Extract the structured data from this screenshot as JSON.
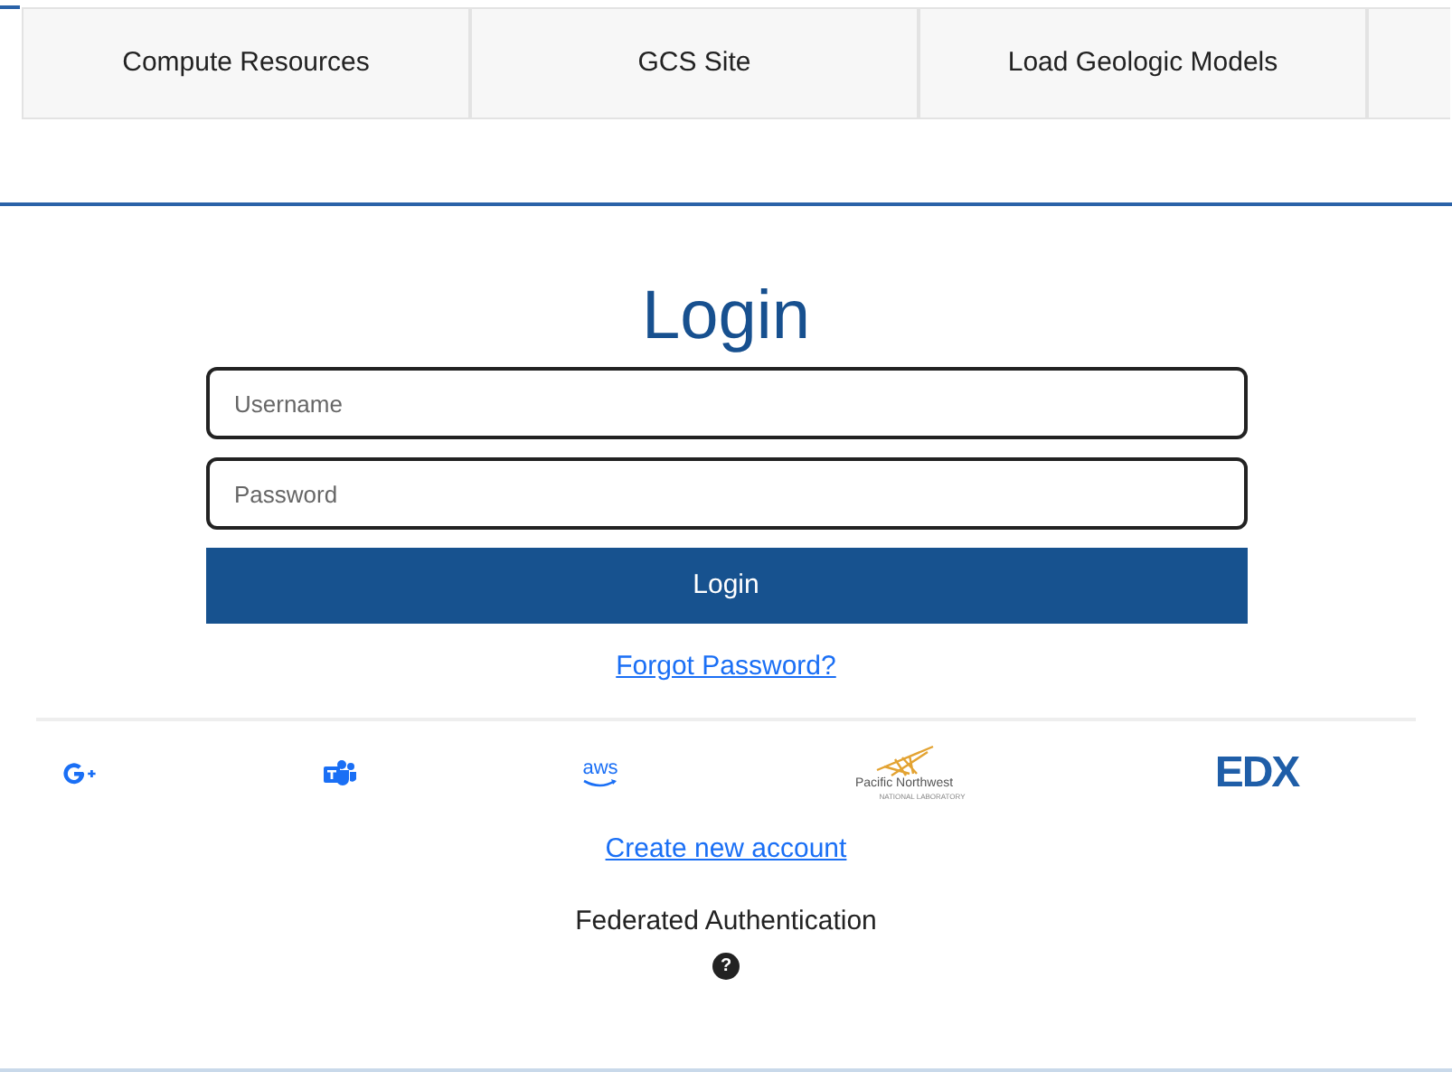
{
  "tabs": [
    {
      "kind": "tab",
      "label": "Compute Resources"
    },
    {
      "kind": "tab",
      "label": "GCS Site"
    },
    {
      "kind": "tab",
      "label": "Load Geologic Models"
    },
    {
      "kind": "partial"
    }
  ],
  "login": {
    "title": "Login",
    "username": {
      "placeholder": "Username"
    },
    "password": {
      "placeholder": "Password"
    },
    "button": "Login",
    "forgot_link": "Forgot Password?"
  },
  "providers": [
    {
      "kind": "google"
    },
    {
      "kind": "teams"
    },
    {
      "kind": "aws",
      "label": "aws"
    },
    {
      "kind": "pnnl",
      "label": "Pacific Northwest",
      "sublabel": "NATIONAL LABORATORY"
    },
    {
      "kind": "edx",
      "label": "EDX"
    }
  ],
  "create_account_link": "Create new account",
  "federated": {
    "label": "Federated Authentication",
    "help": "?"
  }
}
